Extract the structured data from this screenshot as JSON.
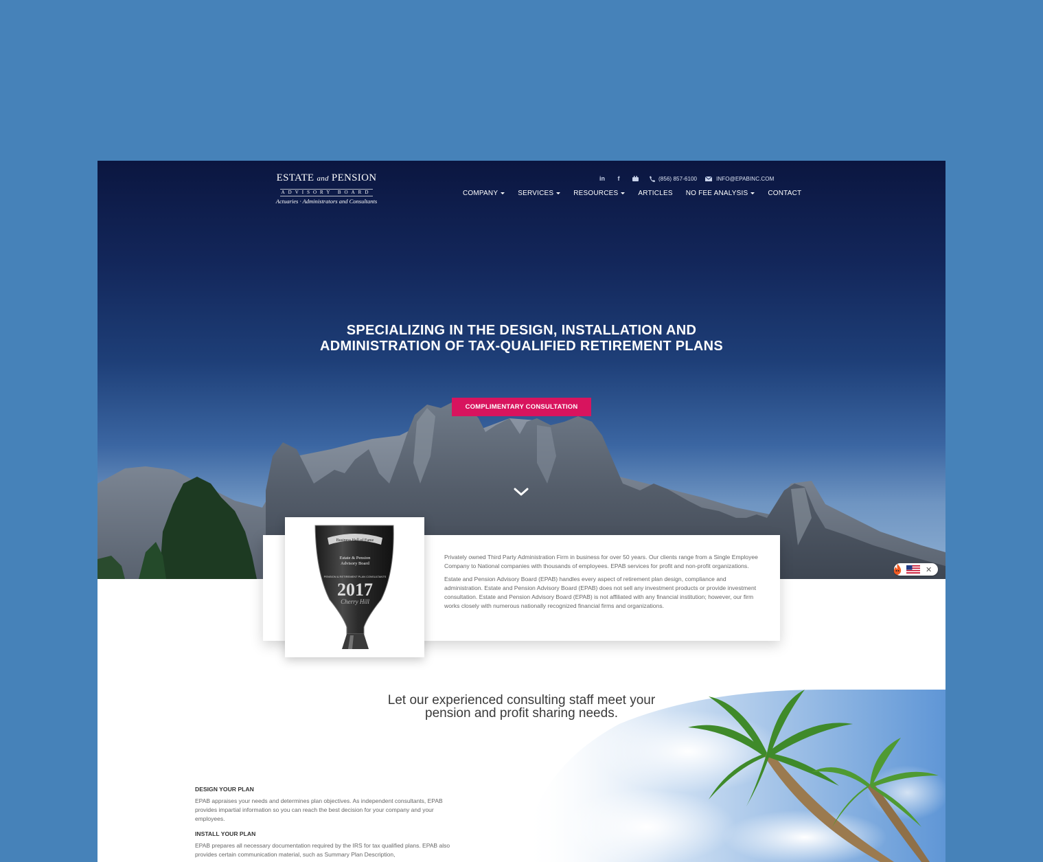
{
  "logo": {
    "line1_a": "ESTATE",
    "line1_b": "and",
    "line1_c": "PENSION",
    "line2": "ADVISORY BOARD",
    "tagline": "Actuaries · Administrators and Consultants"
  },
  "topbar": {
    "phone": "(856) 857-6100",
    "email": "INFO@EPABINC.COM"
  },
  "nav": {
    "company": "COMPANY",
    "services": "SERVICES",
    "resources": "RESOURCES",
    "articles": "ARTICLES",
    "no_fee_analysis": "NO FEE ANALYSIS",
    "contact": "CONTACT"
  },
  "hero": {
    "headline_line1": "SPECIALIZING IN THE DESIGN, INSTALLATION AND",
    "headline_line2": "ADMINISTRATION OF TAX-QUALIFIED RETIREMENT PLANS",
    "cta": "COMPLIMENTARY CONSULTATION"
  },
  "about": {
    "para1": "Privately owned Third Party Administration Firm in business for over 50 years. Our clients range from a Single Employee Company to National companies with thousands of employees. EPAB services for profit and non-profit organizations.",
    "para2": "Estate and Pension Advisory Board (EPAB) handles every aspect of retirement plan design, compliance and administration. Estate and Pension Advisory Board (EPAB) does not sell any investment products or provide investment consultation. Estate and Pension Advisory Board (EPAB) is not affiliated with any financial institution; however, our firm works closely with numerous nationally recognized financial firms and organizations."
  },
  "award": {
    "ribbon": "Business Hall of Fame",
    "name1": "Estate & Pension",
    "name2": "Advisory Board",
    "category": "PENSION & RETIREMENT PLAN CONSULTANTS",
    "year": "2017",
    "city": "Cherry Hill"
  },
  "section2": {
    "headline_line1": "Let our experienced consulting staff meet your",
    "headline_line2": "pension and profit sharing needs.",
    "items": [
      {
        "title": "DESIGN YOUR PLAN",
        "text": "EPAB appraises your needs and determines plan objectives. As independent consultants, EPAB provides impartial information so you can reach the best decision for your company and your employees."
      },
      {
        "title": "INSTALL YOUR PLAN",
        "text": "EPAB prepares all necessary documentation required by the IRS for tax qualified plans. EPAB also provides certain communication material, such as Summary Plan Description,"
      }
    ]
  },
  "colors": {
    "page_bg": "#4682b9",
    "hero_top": "#0b1640",
    "cta": "#d8145e"
  },
  "icons": [
    "linkedin-icon",
    "facebook-icon",
    "youtube-icon",
    "phone-icon",
    "envelope-icon",
    "chevron-down-icon",
    "flag-us-icon",
    "close-icon",
    "fire-icon"
  ]
}
